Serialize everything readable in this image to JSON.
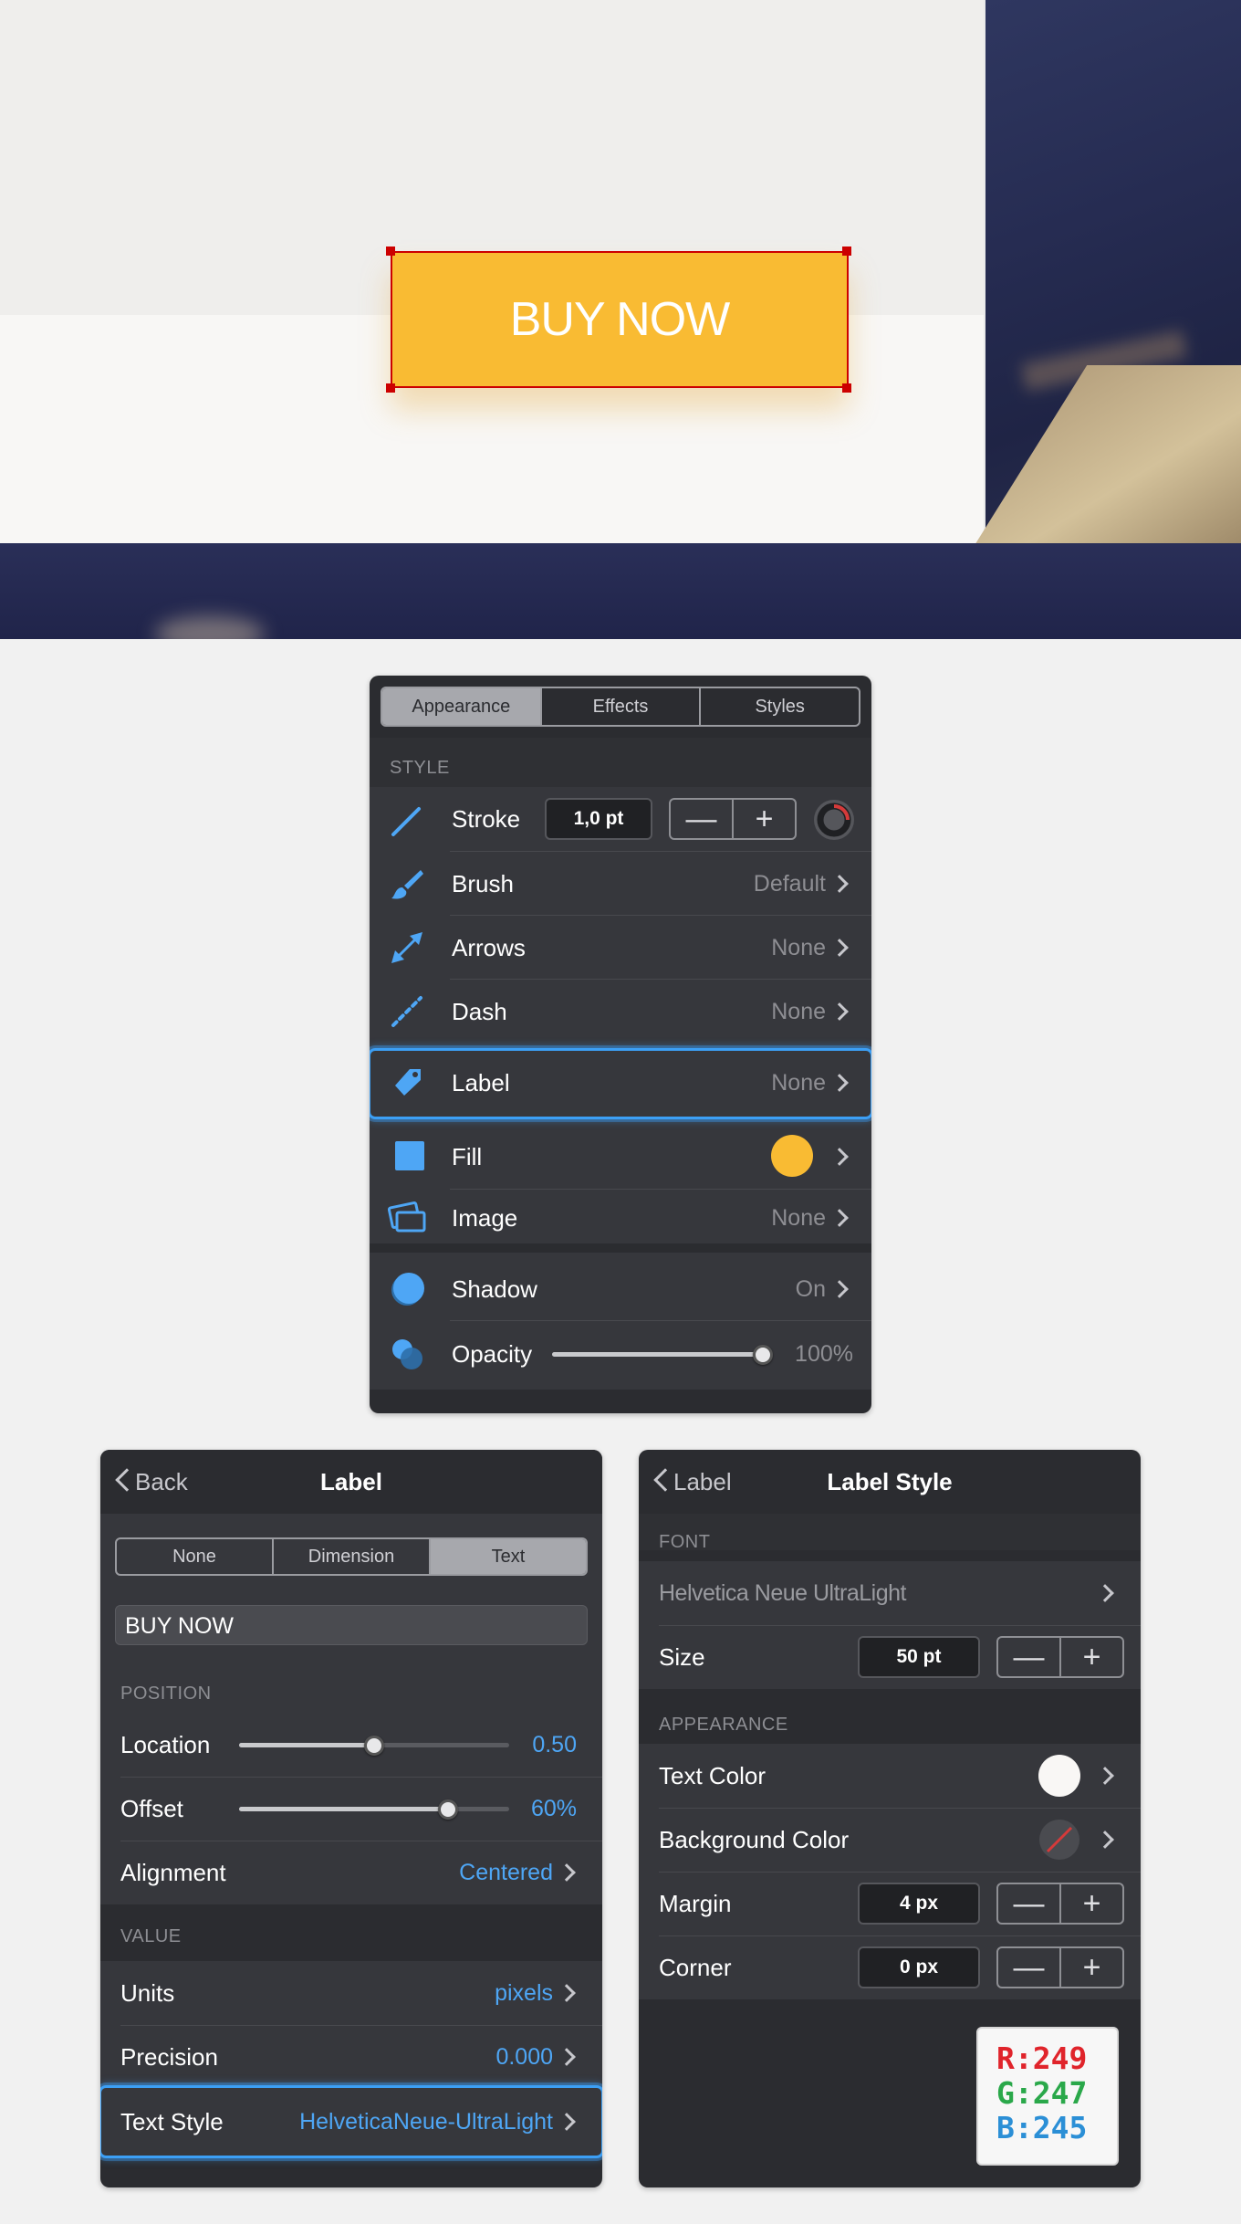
{
  "canvas": {
    "button_text": "BUY NOW",
    "button_color": "#f9bb33",
    "selection_color": "#cc0000"
  },
  "style_panel": {
    "tabs": [
      "Appearance",
      "Effects",
      "Styles"
    ],
    "active_tab": "Appearance",
    "section_label": "STYLE",
    "rows": {
      "stroke": {
        "label": "Stroke",
        "value": "1,0 pt",
        "minus": "—",
        "plus": "+"
      },
      "brush": {
        "label": "Brush",
        "value": "Default"
      },
      "arrows": {
        "label": "Arrows",
        "value": "None"
      },
      "dash": {
        "label": "Dash",
        "value": "None"
      },
      "label": {
        "label": "Label",
        "value": "None"
      },
      "fill": {
        "label": "Fill",
        "color": "#f9bb33"
      },
      "image": {
        "label": "Image",
        "value": "None"
      },
      "shadow": {
        "label": "Shadow",
        "value": "On"
      },
      "opacity": {
        "label": "Opacity",
        "value": "100%",
        "level": 1.0
      }
    }
  },
  "label_panel": {
    "back": "Back",
    "title": "Label",
    "segments": [
      "None",
      "Dimension",
      "Text"
    ],
    "active_segment": "Text",
    "text_value": "BUY NOW",
    "position_label": "POSITION",
    "location": {
      "label": "Location",
      "value": "0.50",
      "level": 0.5
    },
    "offset": {
      "label": "Offset",
      "value": "60%",
      "level": 0.78
    },
    "alignment": {
      "label": "Alignment",
      "value": "Centered"
    },
    "value_label": "VALUE",
    "units": {
      "label": "Units",
      "value": "pixels"
    },
    "precision": {
      "label": "Precision",
      "value": "0.000"
    },
    "text_style": {
      "label": "Text Style",
      "value": "HelveticaNeue-UltraLight"
    }
  },
  "label_style_panel": {
    "back": "Label",
    "title": "Label Style",
    "font_label": "FONT",
    "font_value": "Helvetica Neue UltraLight",
    "size": {
      "label": "Size",
      "value": "50 pt"
    },
    "appearance_label": "APPEARANCE",
    "text_color": {
      "label": "Text Color",
      "color": "#f9f7f5"
    },
    "background_color": {
      "label": "Background Color"
    },
    "margin": {
      "label": "Margin",
      "value": "4 px"
    },
    "corner": {
      "label": "Corner",
      "value": "0 px"
    },
    "stepper_minus": "—",
    "stepper_plus": "+"
  },
  "rgb_badge": {
    "r": "R:249",
    "g": "G:247",
    "b": "B:245",
    "r_color": "#e0242b",
    "g_color": "#2aa84a",
    "b_color": "#2b8fd6"
  }
}
